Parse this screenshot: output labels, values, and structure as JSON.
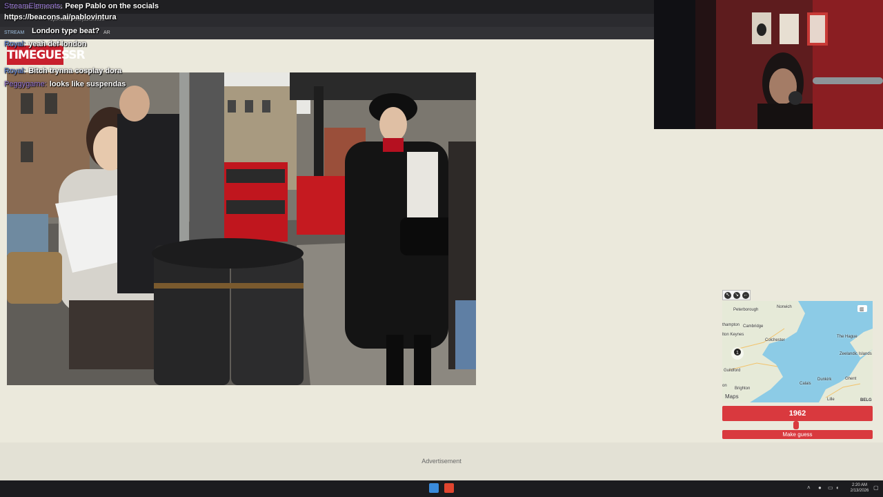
{
  "browser": {
    "tab_title": "Stream Elements",
    "url": "https://beacons.ai/pablovintura",
    "bookmarks": [
      "STREAM",
      "AR"
    ]
  },
  "game": {
    "logo": "TIMEGUESSR",
    "year_value": 1962,
    "year_display": "1962",
    "slider_fraction": 0.49,
    "make_guess_label": "Make guess",
    "advertisement_label": "Advertisement",
    "map_labels": {
      "peterborough": "Peterborough",
      "norwich": "Norwich",
      "cambridge": "Cambridge",
      "northampton": "thampton",
      "milton_keynes": "lton Keynes",
      "colchester": "Colchester",
      "the_hague": "The Hague",
      "zeelandic": "Zeelandic Islands",
      "guildford": "Guildford",
      "brighton": "Brighton",
      "dunkirk": "Dunkirk",
      "ghent": "Ghent",
      "calais": "Calais",
      "lille": "Lille",
      "belgium": "BELG",
      "maps_brand": "Maps",
      "london_edge": "on"
    },
    "pin_label": "1"
  },
  "chat": [
    {
      "user": "StreamElements:",
      "message": "Peep Pablo on the socials"
    },
    {
      "user": "",
      "message": "https://beacons.ai/pablovintura"
    },
    {
      "user": "StreamElements:",
      "message": "London type beat?"
    },
    {
      "user": "Royal:",
      "message": "yeah def london"
    },
    {
      "user": "Royal:",
      "message": "Bitch trynna cosplay dora"
    },
    {
      "user": "Peggygame:",
      "message": "looks like suspendas"
    }
  ],
  "colors": {
    "accent": "#d9393e",
    "page_bg": "#ebe9dc",
    "chat_user_purple": "#9b7ad8",
    "chat_user_blue": "#5a7fd6"
  },
  "taskbar": {
    "time": "2:20 AM",
    "date": "2/13/2026"
  }
}
